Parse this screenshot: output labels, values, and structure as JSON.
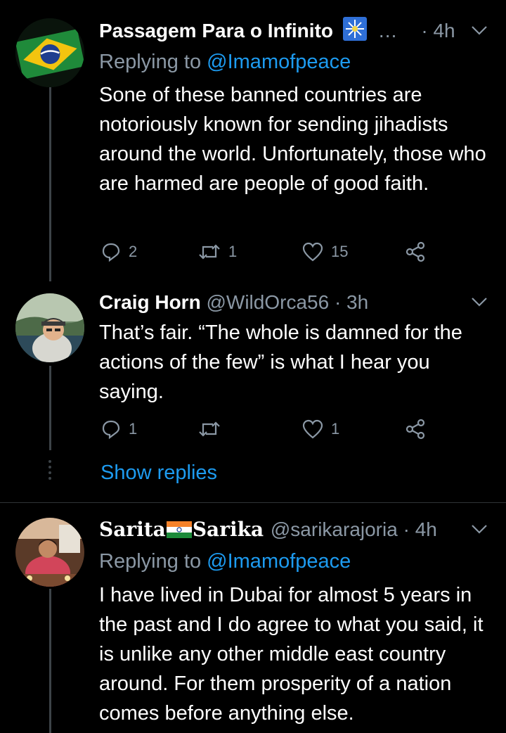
{
  "tweets": [
    {
      "name": "Passagem Para o Infinito",
      "name_suffix": "…",
      "handle": "",
      "dot": "·",
      "time": "4h",
      "replying_prefix": "Replying to",
      "replying_to": "@Imamofpeace",
      "text": "Sone of these banned countries are notoriously known for sending jihadists around the world. Unfortunately, those who are harmed are people of good faith.",
      "replies": "2",
      "retweets": "1",
      "likes": "15",
      "avatar_icon": "brazil-flag-avatar"
    },
    {
      "name": "Craig Horn",
      "handle": "@WildOrca56",
      "dot": "·",
      "time": "3h",
      "text": "That’s fair.  “The whole is damned for the actions of the few” is what I hear you saying.",
      "replies": "1",
      "retweets": "",
      "likes": "1",
      "avatar_icon": "man-with-cap-avatar"
    },
    {
      "name_part1": "Sarita",
      "name_part2": "Sarika",
      "handle": "@sarikarajoria",
      "dot": "·",
      "time": "4h",
      "replying_prefix": "Replying to",
      "replying_to": "@Imamofpeace",
      "text": "I have lived in Dubai for almost 5 years in the past and I do agree to what you said, it is unlike any other middle east country around. For them prosperity of a nation comes before anything else.",
      "avatar_icon": "woman-in-saree-avatar"
    }
  ],
  "show_replies": "Show replies",
  "colors": {
    "background": "#000000",
    "secondary": "#8b98a5",
    "accent": "#1d9bf0"
  }
}
